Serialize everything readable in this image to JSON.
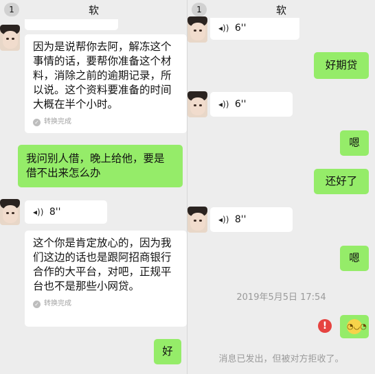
{
  "left": {
    "header": {
      "badge": "1",
      "title": "软"
    },
    "messages": {
      "text_1": "因为是说帮你去阿，解冻这个事情的话，要帮你准备这个材料，消除之前的逾期记录，所以说。这个资料要准备的时间大概在半个小时。",
      "converted_1": "转换完成",
      "sent_1": "我问别人借，晚上给他，要是借不出来怎么办",
      "voice_1": "8''",
      "text_2": "这个你是肯定放心的，因为我们这边的话也是跟阿招商银行合作的大平台，对吧，正规平台也不是那些小网贷。",
      "converted_2": "转换完成",
      "sent_2": "好"
    }
  },
  "right": {
    "header": {
      "badge": "1",
      "title": "软"
    },
    "messages": {
      "voice_1": "6''",
      "sent_1": "好期贷",
      "voice_2": "6''",
      "sent_2": "嗯",
      "sent_3": "还好了",
      "voice_3": "8''",
      "sent_4": "嗯",
      "timestamp": "2019年5月5日 17:54",
      "error_mark": "!",
      "system": "消息已发出，但被对方拒收了。"
    }
  },
  "icons": {
    "voice": "sound-wave-icon",
    "check": "check-icon",
    "emoji": "emoji-icon",
    "error": "error-icon"
  },
  "colors": {
    "sent_bubble": "#95ec69",
    "received_bubble": "#ffffff",
    "background": "#ededed",
    "error": "#e64340"
  }
}
